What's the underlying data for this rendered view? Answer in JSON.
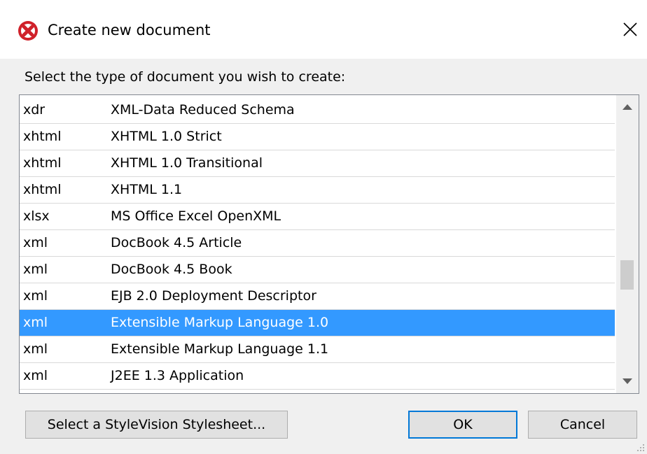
{
  "window": {
    "title": "Create new document",
    "app_icon": "altova-icon",
    "close_icon": "close-icon"
  },
  "prompt": "Select the type of document you wish to create:",
  "list": {
    "rows": [
      {
        "ext": "xdr",
        "desc": "XML-Data Reduced Schema",
        "selected": false
      },
      {
        "ext": "xhtml",
        "desc": "XHTML 1.0 Strict",
        "selected": false
      },
      {
        "ext": "xhtml",
        "desc": "XHTML 1.0 Transitional",
        "selected": false
      },
      {
        "ext": "xhtml",
        "desc": "XHTML 1.1",
        "selected": false
      },
      {
        "ext": "xlsx",
        "desc": "MS Office Excel OpenXML",
        "selected": false
      },
      {
        "ext": "xml",
        "desc": "DocBook 4.5 Article",
        "selected": false
      },
      {
        "ext": "xml",
        "desc": "DocBook 4.5 Book",
        "selected": false
      },
      {
        "ext": "xml",
        "desc": "EJB 2.0 Deployment Descriptor",
        "selected": false
      },
      {
        "ext": "xml",
        "desc": "Extensible Markup Language 1.0",
        "selected": true
      },
      {
        "ext": "xml",
        "desc": "Extensible Markup Language 1.1",
        "selected": false
      },
      {
        "ext": "xml",
        "desc": "J2EE 1.3 Application",
        "selected": false
      }
    ],
    "selection_color": "#3399ff"
  },
  "buttons": {
    "stylesheet_label": "Select a StyleVision Stylesheet...",
    "ok_label": "OK",
    "cancel_label": "Cancel"
  }
}
